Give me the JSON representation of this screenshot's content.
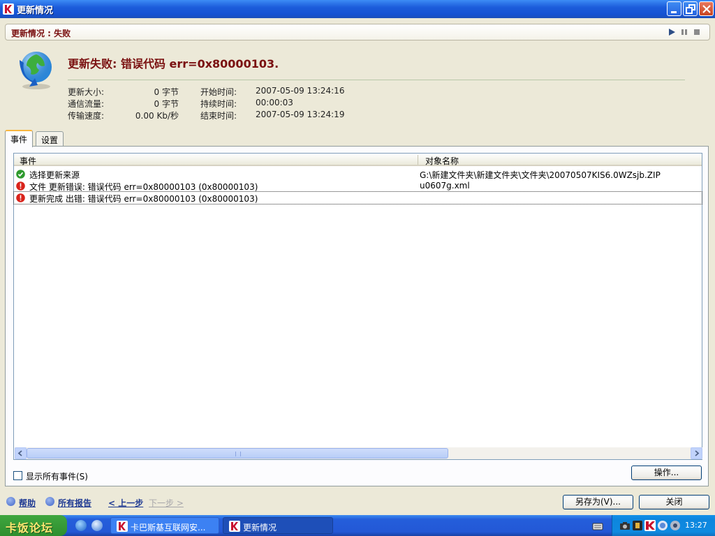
{
  "window": {
    "title": "更新情况"
  },
  "status": {
    "label": "更新情况 : 失败"
  },
  "headline": "更新失败: 错误代码 err=0x80000103.",
  "info": [
    {
      "label": "更新大小:",
      "value": "0 字节",
      "label2": "开始时间:",
      "value2": "2007-05-09 13:24:16"
    },
    {
      "label": "通信流量:",
      "value": "0 字节",
      "label2": "持续时间:",
      "value2": "00:00:03"
    },
    {
      "label": "传输速度:",
      "value": "0.00 Kb/秒",
      "label2": "结束时间:",
      "value2": "2007-05-09 13:24:19"
    }
  ],
  "tabs": [
    {
      "label": "事件"
    },
    {
      "label": "设置"
    }
  ],
  "list": {
    "columns": {
      "event": "事件",
      "object": "对象名称"
    },
    "rows": [
      {
        "status": "ok",
        "event": "选择更新来源",
        "object": "G:\\新建文件夹\\新建文件夹\\文件夹\\20070507KIS6.0WZsjb.ZIP"
      },
      {
        "status": "error",
        "event": "文件 更新错误: 错误代码 err=0x80000103 (0x80000103)",
        "object": "u0607g.xml"
      },
      {
        "status": "error",
        "event": "更新完成 出错: 错误代码 err=0x80000103 (0x80000103)",
        "object": ""
      }
    ]
  },
  "show_all": {
    "label": "显示所有事件(S)",
    "checked": false
  },
  "actions_button": "操作...",
  "footer": {
    "help": "帮助",
    "reports": "所有报告",
    "prev": "< 上一步",
    "next": "下一步 >",
    "save_as": "另存为(V)...",
    "close": "关闭"
  },
  "taskbar": {
    "start_label": "卡饭论坛",
    "tasks": [
      {
        "label": "卡巴斯基互联网安..."
      },
      {
        "label": "更新情况"
      }
    ],
    "clock": "13:27"
  },
  "colors": {
    "accent": "#7A1010",
    "error": "#D9231B",
    "ok": "#2E9A2E",
    "title_blue": "#1C5CDB"
  }
}
